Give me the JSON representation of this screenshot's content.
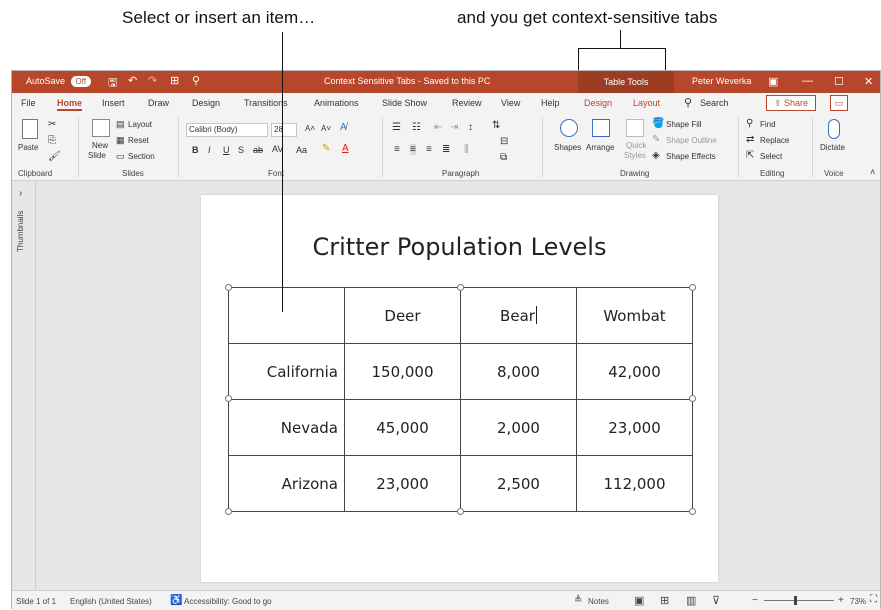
{
  "annotations": {
    "left": "Select or insert an item…",
    "right": "and you get context-sensitive tabs"
  },
  "titlebar": {
    "autosave_label": "AutoSave",
    "autosave_state": "Off",
    "document_title": "Context Sensitive Tabs - Saved to this PC",
    "contextual_group": "Table Tools",
    "user": "Peter Weverka"
  },
  "menu": {
    "tabs": [
      "File",
      "Home",
      "Insert",
      "Draw",
      "Design",
      "Transitions",
      "Animations",
      "Slide Show",
      "Review",
      "View",
      "Help"
    ],
    "contextual_tabs": [
      "Design",
      "Layout"
    ],
    "search_label": "Search",
    "share_label": "Share",
    "active_tab": "Home"
  },
  "ribbon": {
    "groups": [
      "Clipboard",
      "Slides",
      "Font",
      "Paragraph",
      "Drawing",
      "Editing",
      "Voice"
    ],
    "clipboard": {
      "paste_label": "Paste"
    },
    "slides": {
      "new_slide": "New",
      "new_slide_2": "Slide",
      "layout": "Layout",
      "reset": "Reset",
      "section": "Section"
    },
    "font": {
      "font_name": "Calibri (Body)",
      "font_size": "28",
      "bold": "B",
      "italic": "I",
      "underline": "U",
      "strike": "S",
      "spacing": "ab",
      "case": "Aa",
      "grow": "A˄",
      "shrink": "A˅"
    },
    "drawing": {
      "shapes": "Shapes",
      "arrange": "Arrange",
      "quick_styles": "Quick",
      "quick_styles_2": "Styles",
      "shape_fill": "Shape Fill",
      "shape_outline": "Shape Outline",
      "shape_effects": "Shape Effects"
    },
    "editing": {
      "find": "Find",
      "replace": "Replace",
      "select": "Select"
    },
    "voice": {
      "dictate": "Dictate"
    }
  },
  "thumbnails": {
    "label": "Thumbnails"
  },
  "slide": {
    "title": "Critter Population Levels",
    "table": {
      "header": [
        "",
        "Deer",
        "Bear",
        "Wombat"
      ],
      "rows": [
        [
          "California",
          "150,000",
          "8,000",
          "42,000"
        ],
        [
          "Nevada",
          "45,000",
          "2,000",
          "23,000"
        ],
        [
          "Arizona",
          "23,000",
          "2,500",
          "112,000"
        ]
      ]
    }
  },
  "statusbar": {
    "slide_info": "Slide 1 of 1",
    "language": "English (United States)",
    "accessibility": "Accessibility: Good to go",
    "notes": "Notes",
    "zoom": "73%"
  }
}
